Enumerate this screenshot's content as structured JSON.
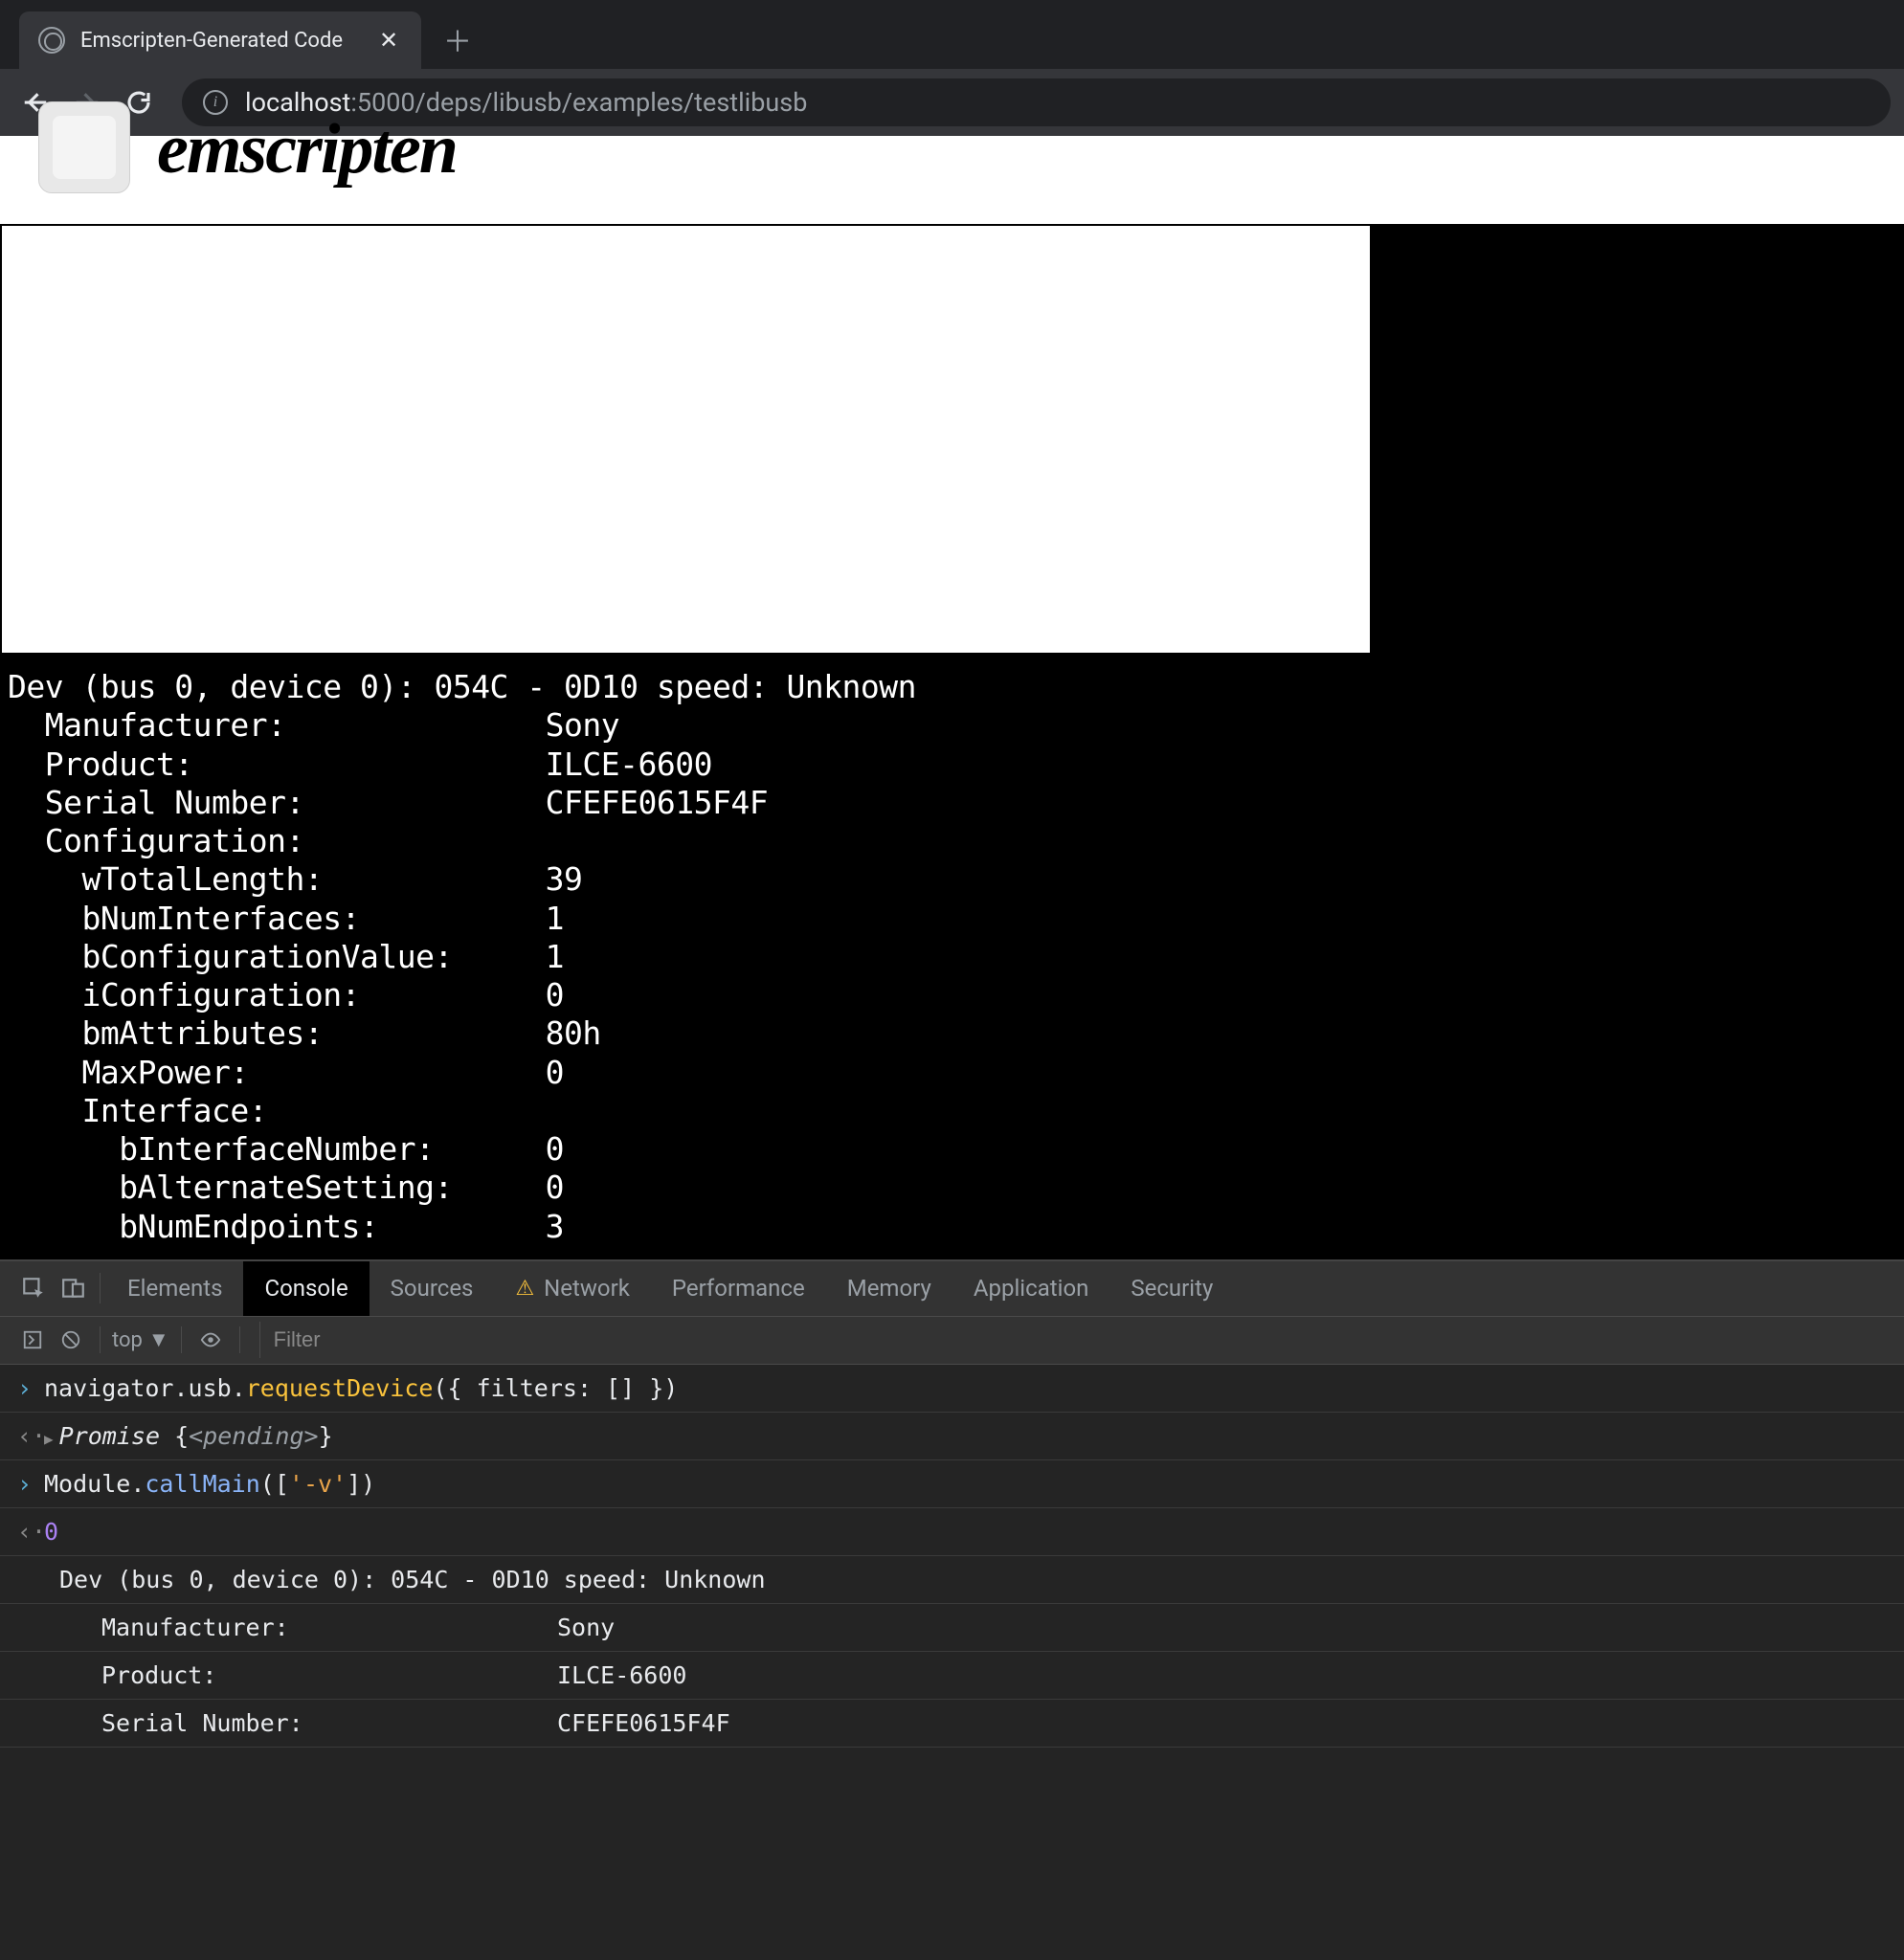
{
  "browser": {
    "tab_title": "Emscripten-Generated Code",
    "url_host": "localhost",
    "url_port": ":5000",
    "url_path": "/deps/libusb/examples/testlibusb"
  },
  "page": {
    "logo_text": "emscripten"
  },
  "terminal": {
    "lines": [
      "Dev (bus 0, device 0): 054C - 0D10 speed: Unknown",
      "  Manufacturer:              Sony",
      "  Product:                   ILCE-6600",
      "  Serial Number:             CFEFE0615F4F",
      "  Configuration:",
      "    wTotalLength:            39",
      "    bNumInterfaces:          1",
      "    bConfigurationValue:     1",
      "    iConfiguration:          0",
      "    bmAttributes:            80h",
      "    MaxPower:                0",
      "    Interface:",
      "      bInterfaceNumber:      0",
      "      bAlternateSetting:     0",
      "      bNumEndpoints:         3"
    ]
  },
  "devtools": {
    "tabs": [
      "Elements",
      "Console",
      "Sources",
      "Network",
      "Performance",
      "Memory",
      "Application",
      "Security"
    ],
    "active_tab": "Console",
    "warn_tab": "Network",
    "console_toolbar": {
      "context": "top",
      "filter_placeholder": "Filter"
    },
    "console": {
      "entries": [
        {
          "kind": "input",
          "tokens": [
            {
              "t": "navigator",
              "c": "obj"
            },
            {
              "t": ".",
              "c": ""
            },
            {
              "t": "usb",
              "c": "obj"
            },
            {
              "t": ".",
              "c": ""
            },
            {
              "t": "requestDevice",
              "c": "prop-y"
            },
            {
              "t": "({ ",
              "c": ""
            },
            {
              "t": "filters",
              "c": "obj"
            },
            {
              "t": ": [] })",
              "c": ""
            }
          ]
        },
        {
          "kind": "output",
          "expand": true,
          "tokens": [
            {
              "t": "Promise ",
              "c": "promise"
            },
            {
              "t": "{",
              "c": ""
            },
            {
              "t": "<pending>",
              "c": "status"
            },
            {
              "t": "}",
              "c": ""
            }
          ]
        },
        {
          "kind": "input",
          "tokens": [
            {
              "t": "Module",
              "c": "obj"
            },
            {
              "t": ".",
              "c": ""
            },
            {
              "t": "callMain",
              "c": "method"
            },
            {
              "t": "([",
              "c": ""
            },
            {
              "t": "'-v'",
              "c": "str"
            },
            {
              "t": "])",
              "c": ""
            }
          ]
        },
        {
          "kind": "output",
          "tokens": [
            {
              "t": "0",
              "c": "num"
            }
          ]
        }
      ],
      "table_header": "Dev (bus 0, device 0): 054C - 0D10 speed: Unknown",
      "table_rows": [
        {
          "k": "Manufacturer:",
          "v": "Sony"
        },
        {
          "k": "Product:",
          "v": "ILCE-6600"
        },
        {
          "k": "Serial Number:",
          "v": "CFEFE0615F4F"
        }
      ]
    }
  }
}
